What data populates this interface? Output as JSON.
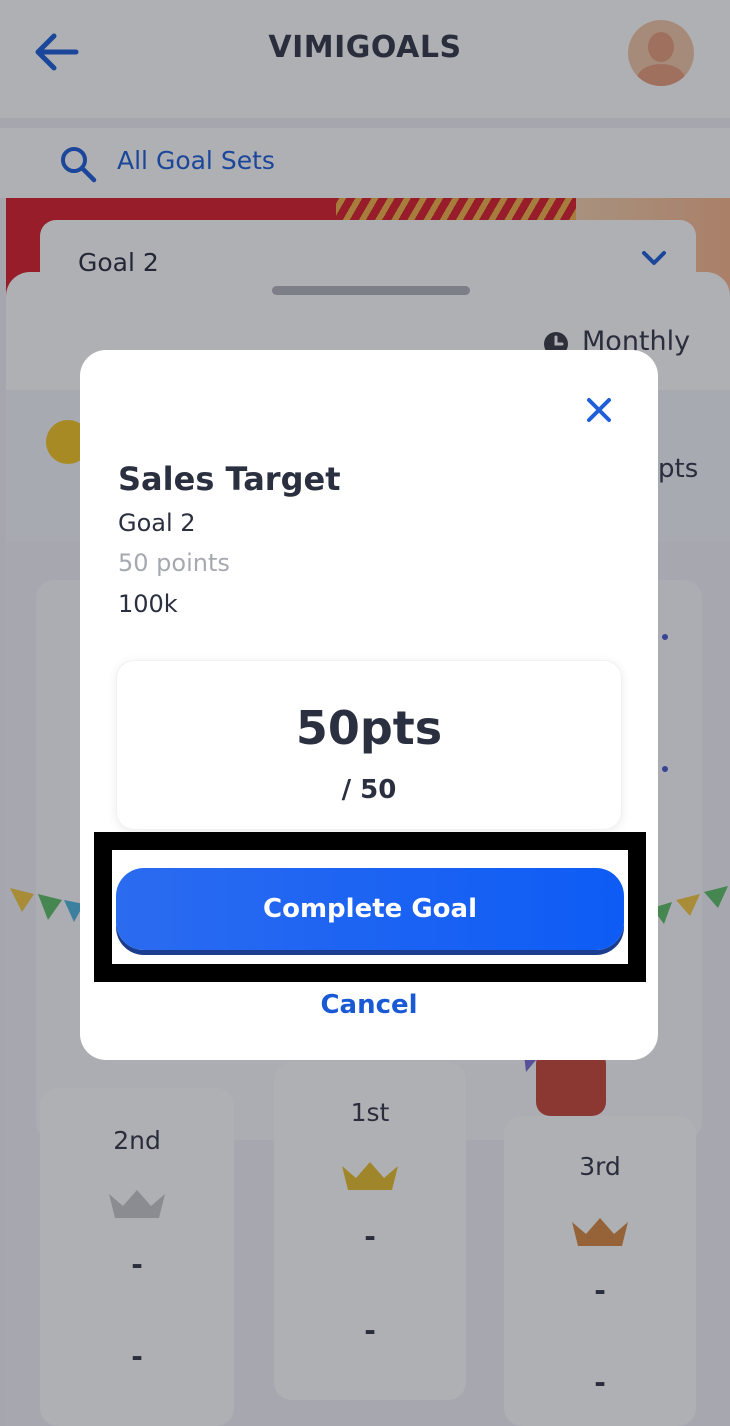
{
  "header": {
    "title": "VIMIGOALS",
    "back_icon": "back-arrow-icon",
    "avatar_icon": "user-avatar"
  },
  "search": {
    "label": "All Goal Sets",
    "icon": "search-icon"
  },
  "goal_selector": {
    "selected": "Goal 2",
    "icon": "chevron-down-icon"
  },
  "sheet": {
    "period_label": "Monthly",
    "points_suffix": "pts"
  },
  "podium": [
    {
      "rank": "2nd",
      "name": "-",
      "score": "-",
      "crown_color": "#c7c8cc"
    },
    {
      "rank": "1st",
      "name": "-",
      "score": "-",
      "crown_color": "#e8c02e"
    },
    {
      "rank": "3rd",
      "name": "-",
      "score": "-",
      "crown_color": "#d98a45"
    }
  ],
  "modal": {
    "title": "Sales Target",
    "goal_name": "Goal 2",
    "points_text": "50 points",
    "target_text": "100k",
    "progress_value": "50pts",
    "progress_total": "/ 50",
    "complete_label": "Complete Goal",
    "cancel_label": "Cancel"
  },
  "colors": {
    "accent": "#1f5fd8",
    "button": "#1a63f2",
    "banner": "#d9212c"
  }
}
